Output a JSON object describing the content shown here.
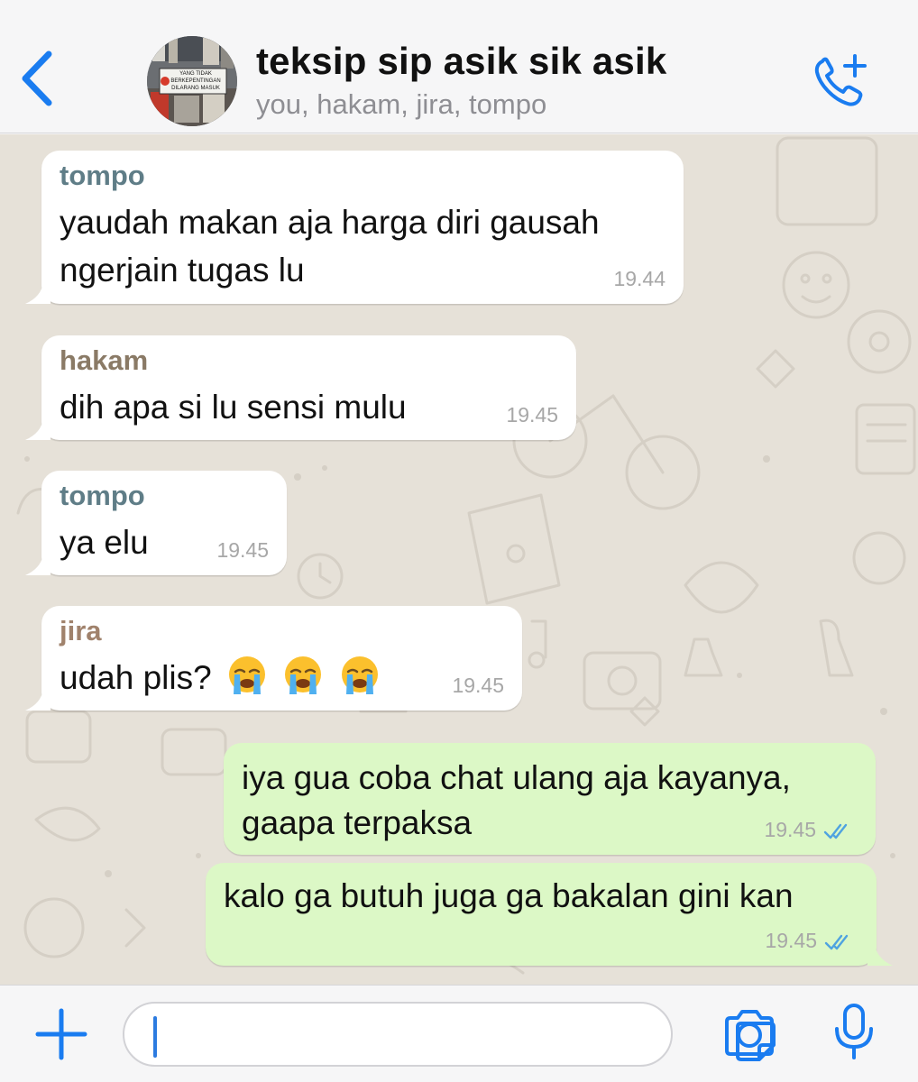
{
  "header": {
    "title": "teksip sip asik sik asik",
    "subtitle": "you, hakam, jira, tompo",
    "avatar_sign_lines": [
      "YANG TIDAK",
      "BERKEPENTINGAN",
      "DILARANG MASUK"
    ],
    "accent_color": "#1a7cf0"
  },
  "messages": [
    {
      "sender": "tompo",
      "sender_color": "#5f7d87",
      "lines": [
        "yaudah makan aja harga diri gausah",
        "ngerjain tugas lu"
      ],
      "time": "19.44",
      "direction": "incoming"
    },
    {
      "sender": "hakam",
      "sender_color": "#8a7a66",
      "lines": [
        "dih apa si lu sensi mulu"
      ],
      "time": "19.45",
      "direction": "incoming"
    },
    {
      "sender": "tompo",
      "sender_color": "#5f7d87",
      "lines": [
        "ya elu"
      ],
      "time": "19.45",
      "direction": "incoming"
    },
    {
      "sender": "jira",
      "sender_color": "#a0826c",
      "lines": [
        "udah plis?"
      ],
      "emojis": [
        "loudly-crying-face",
        "loudly-crying-face",
        "loudly-crying-face"
      ],
      "time": "19.45",
      "direction": "incoming"
    },
    {
      "sender": "",
      "lines": [
        "iya gua coba chat ulang aja kayanya,",
        "gaapa terpaksa"
      ],
      "time": "19.45",
      "direction": "outgoing",
      "status": "read"
    },
    {
      "sender": "",
      "lines": [
        "kalo ga butuh juga ga bakalan gini kan"
      ],
      "time": "19.45",
      "direction": "outgoing",
      "status": "read"
    }
  ],
  "composer": {
    "value": "",
    "placeholder": ""
  },
  "icons": [
    "back-chevron-icon",
    "add-call-icon",
    "plus-icon",
    "sticker-icon",
    "camera-icon",
    "microphone-icon",
    "double-check-icon"
  ],
  "colors": {
    "incoming_bubble": "#ffffff",
    "outgoing_bubble": "#dcf8c6",
    "wallpaper": "#e6e1d8",
    "read_ticks": "#4fa3e0"
  }
}
